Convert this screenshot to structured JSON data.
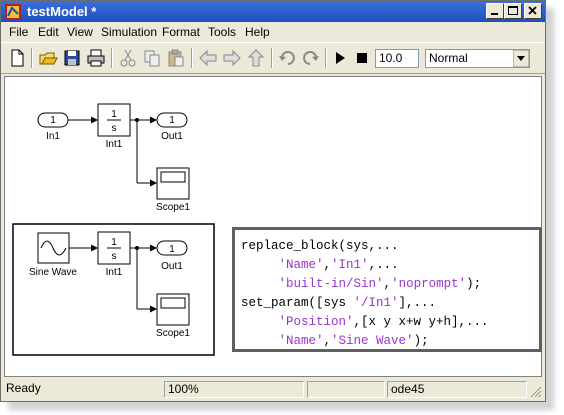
{
  "window": {
    "title": "testModel *"
  },
  "menu": [
    "File",
    "Edit",
    "View",
    "Simulation",
    "Format",
    "Tools",
    "Help"
  ],
  "toolbar": {
    "stop_time": "10.0",
    "sim_mode": "Normal",
    "icons": [
      "new-model-icon",
      "open-icon",
      "save-icon",
      "print-icon",
      "cut-icon",
      "copy-icon",
      "paste-icon",
      "back-icon",
      "forward-icon",
      "up-icon",
      "undo-icon",
      "redo-icon",
      "start-simulation-icon",
      "stop-simulation-icon"
    ]
  },
  "diagram_top": {
    "in_port": {
      "num": "1",
      "label": "In1"
    },
    "integrator": {
      "num": "1",
      "den": "s",
      "label": "Int1"
    },
    "out_port": {
      "num": "1",
      "label": "Out1"
    },
    "scope": {
      "label": "Scope1"
    }
  },
  "diagram_bottom": {
    "sine": {
      "label": "Sine Wave"
    },
    "integrator": {
      "num": "1",
      "den": "s",
      "label": "Int1"
    },
    "out_port": {
      "num": "1",
      "label": "Out1"
    },
    "scope": {
      "label": "Scope1"
    }
  },
  "code_lines": [
    [
      {
        "t": "replace_block(sys,...",
        "s": false
      }
    ],
    [
      {
        "t": "     ",
        "s": false
      },
      {
        "t": "'Name'",
        "s": true
      },
      {
        "t": ",",
        "s": false
      },
      {
        "t": "'In1'",
        "s": true
      },
      {
        "t": ",...",
        "s": false
      }
    ],
    [
      {
        "t": "     ",
        "s": false
      },
      {
        "t": "'built-in/Sin'",
        "s": true
      },
      {
        "t": ",",
        "s": false
      },
      {
        "t": "'noprompt'",
        "s": true
      },
      {
        "t": ");",
        "s": false
      }
    ],
    [
      {
        "t": "set_param([sys ",
        "s": false
      },
      {
        "t": "'/In1'",
        "s": true
      },
      {
        "t": "],...",
        "s": false
      }
    ],
    [
      {
        "t": "     ",
        "s": false
      },
      {
        "t": "'Position'",
        "s": true
      },
      {
        "t": ",[x y x+w y+h],...",
        "s": false
      }
    ],
    [
      {
        "t": "     ",
        "s": false
      },
      {
        "t": "'Name'",
        "s": true
      },
      {
        "t": ",",
        "s": false
      },
      {
        "t": "'Sine Wave'",
        "s": true
      },
      {
        "t": ");",
        "s": false
      }
    ]
  ],
  "status": {
    "left": "Ready",
    "zoom": "100%",
    "solver": "ode45"
  }
}
